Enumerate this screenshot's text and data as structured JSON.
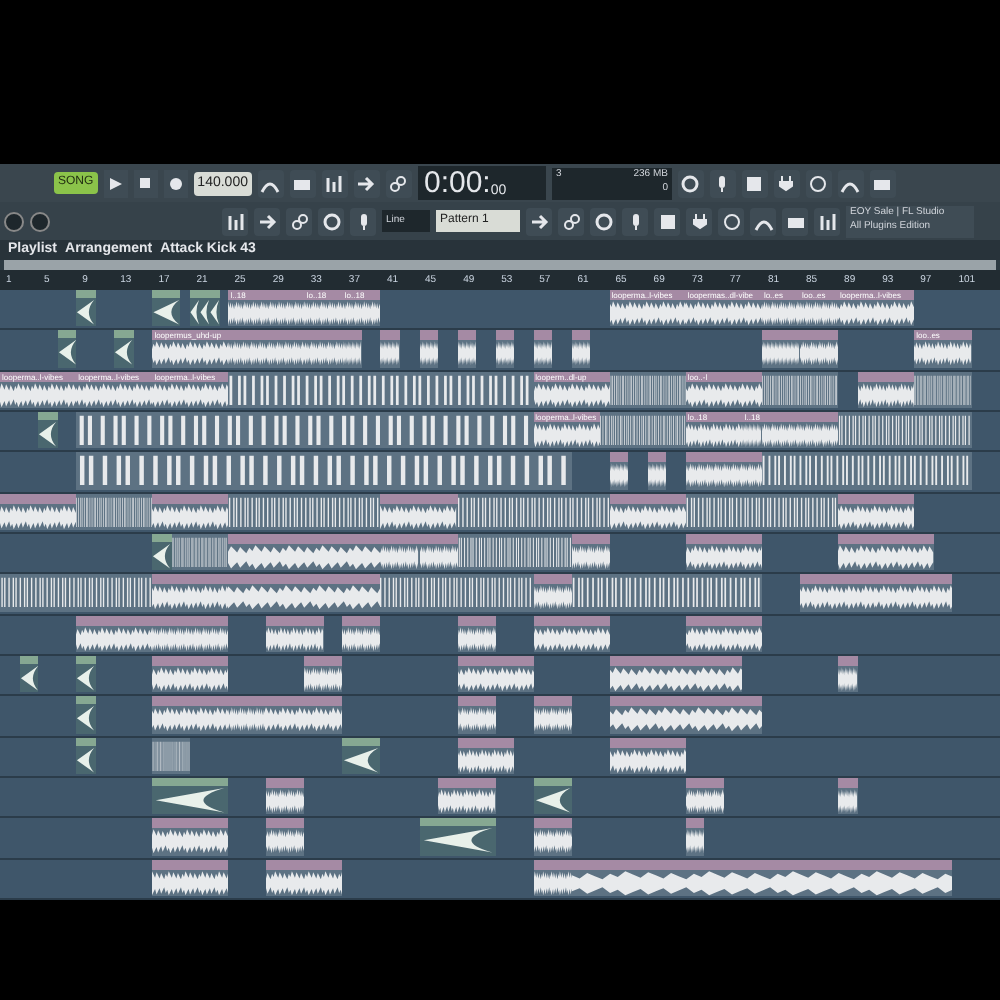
{
  "toolbar": {
    "mode": "SONG",
    "tempo": "140.000",
    "time": "0:00:",
    "time_small": "00",
    "cpu": "3",
    "memory": "236 MB",
    "voices": "0",
    "snap": "Line",
    "pattern": "Pattern 1",
    "news": "EOY Sale | FL Studio",
    "news_sub": "All Plugins Edition"
  },
  "breadcrumb": [
    "Playlist",
    "Arrangement",
    "Attack Kick 43"
  ],
  "ruler": [
    "1",
    "5",
    "9",
    "13",
    "17",
    "21",
    "25",
    "29",
    "33",
    "37",
    "41",
    "45",
    "49",
    "53",
    "57",
    "61",
    "65",
    "69",
    "73",
    "77",
    "81",
    "85",
    "89",
    "93",
    "97",
    "101"
  ],
  "tracks": [
    {
      "clips": [
        {
          "kind": "pattern"
        },
        {
          "kind": "pattern"
        },
        {
          "kind": "pattern"
        },
        {
          "kind": "pattern"
        },
        {
          "kind": "pattern"
        },
        {
          "kind": "audio",
          "label": "l..18"
        },
        {
          "kind": "audio"
        },
        {
          "kind": "audio",
          "label": "lo..18"
        },
        {
          "kind": "audio",
          "label": "lo..18"
        },
        {
          "kind": "audio",
          "label": "looperma..l-vibes"
        },
        {
          "kind": "audio",
          "label": "loopermas..dl-vibe"
        },
        {
          "kind": "audio",
          "label": "lo..es"
        },
        {
          "kind": "audio",
          "label": "loo..es"
        },
        {
          "kind": "audio",
          "label": "looperma..l-vibes"
        }
      ]
    },
    {
      "clips": [
        {
          "kind": "pattern"
        },
        {
          "kind": "pattern"
        },
        {
          "kind": "audio",
          "label": "loopermus_uhd-up"
        },
        {
          "kind": "audio"
        },
        {
          "kind": "audio"
        },
        {
          "kind": "audio"
        },
        {
          "kind": "audio"
        },
        {
          "kind": "audio"
        },
        {
          "kind": "audio"
        },
        {
          "kind": "audio"
        },
        {
          "kind": "audio"
        },
        {
          "kind": "audio"
        },
        {
          "kind": "audio"
        },
        {
          "kind": "audio"
        },
        {
          "kind": "audio"
        },
        {
          "kind": "audio"
        },
        {
          "kind": "audio",
          "label": "loo..es"
        }
      ]
    },
    {
      "clips": [
        {
          "kind": "audio",
          "label": "looperma..l-vibes"
        },
        {
          "kind": "audio",
          "label": "looperma..l-vibes"
        },
        {
          "kind": "audio",
          "label": "looperma..l-vibes"
        },
        {
          "kind": "slices"
        },
        {
          "kind": "audio",
          "label": "looperm..dl-up"
        },
        {
          "kind": "slices"
        },
        {
          "kind": "audio",
          "label": "loo..-l"
        },
        {
          "kind": "slices"
        },
        {
          "kind": "audio"
        },
        {
          "kind": "slices"
        }
      ]
    },
    {
      "clips": [
        {
          "kind": "pattern"
        },
        {
          "kind": "slices"
        },
        {
          "kind": "audio",
          "label": "looperma..l-vibes"
        },
        {
          "kind": "slices"
        },
        {
          "kind": "audio",
          "label": "lo..18"
        },
        {
          "kind": "audio",
          "label": "l..18"
        },
        {
          "kind": "audio"
        },
        {
          "kind": "audio"
        },
        {
          "kind": "slices"
        }
      ]
    },
    {
      "clips": [
        {
          "kind": "slices"
        },
        {
          "kind": "audio"
        },
        {
          "kind": "audio"
        },
        {
          "kind": "audio"
        },
        {
          "kind": "audio"
        },
        {
          "kind": "slices"
        }
      ]
    },
    {
      "clips": [
        {
          "kind": "audio"
        },
        {
          "kind": "slices"
        },
        {
          "kind": "audio"
        },
        {
          "kind": "slices"
        },
        {
          "kind": "audio"
        },
        {
          "kind": "slices"
        },
        {
          "kind": "audio"
        },
        {
          "kind": "slices"
        },
        {
          "kind": "audio"
        }
      ]
    },
    {
      "clips": [
        {
          "kind": "pattern"
        },
        {
          "kind": "slices"
        },
        {
          "kind": "audio"
        },
        {
          "kind": "audio"
        },
        {
          "kind": "audio"
        },
        {
          "kind": "slices"
        },
        {
          "kind": "audio"
        },
        {
          "kind": "audio"
        },
        {
          "kind": "audio"
        }
      ]
    },
    {
      "clips": [
        {
          "kind": "slices"
        },
        {
          "kind": "audio"
        },
        {
          "kind": "audio"
        },
        {
          "kind": "slices"
        },
        {
          "kind": "audio"
        },
        {
          "kind": "slices"
        },
        {
          "kind": "audio"
        },
        {
          "kind": "audio"
        }
      ]
    },
    {
      "clips": [
        {
          "kind": "audio"
        },
        {
          "kind": "audio"
        },
        {
          "kind": "audio"
        },
        {
          "kind": "audio"
        },
        {
          "kind": "audio"
        },
        {
          "kind": "audio"
        },
        {
          "kind": "audio"
        },
        {
          "kind": "audio"
        }
      ]
    },
    {
      "clips": [
        {
          "kind": "pattern"
        },
        {
          "kind": "pattern"
        },
        {
          "kind": "audio"
        },
        {
          "kind": "audio"
        },
        {
          "kind": "audio"
        },
        {
          "kind": "audio"
        },
        {
          "kind": "audio"
        }
      ]
    },
    {
      "clips": [
        {
          "kind": "pattern"
        },
        {
          "kind": "audio"
        },
        {
          "kind": "audio"
        },
        {
          "kind": "audio"
        },
        {
          "kind": "audio"
        },
        {
          "kind": "audio"
        },
        {
          "kind": "audio"
        }
      ]
    },
    {
      "clips": [
        {
          "kind": "pattern"
        },
        {
          "kind": "slices"
        },
        {
          "kind": "pattern"
        },
        {
          "kind": "audio"
        },
        {
          "kind": "audio"
        }
      ]
    },
    {
      "clips": [
        {
          "kind": "pattern"
        },
        {
          "kind": "audio"
        },
        {
          "kind": "audio"
        },
        {
          "kind": "pattern"
        },
        {
          "kind": "audio"
        },
        {
          "kind": "audio"
        }
      ]
    },
    {
      "clips": [
        {
          "kind": "audio"
        },
        {
          "kind": "audio"
        },
        {
          "kind": "pattern"
        },
        {
          "kind": "audio"
        },
        {
          "kind": "audio"
        }
      ]
    },
    {
      "clips": [
        {
          "kind": "audio"
        },
        {
          "kind": "audio"
        },
        {
          "kind": "audio"
        },
        {
          "kind": "audio"
        }
      ]
    }
  ]
}
